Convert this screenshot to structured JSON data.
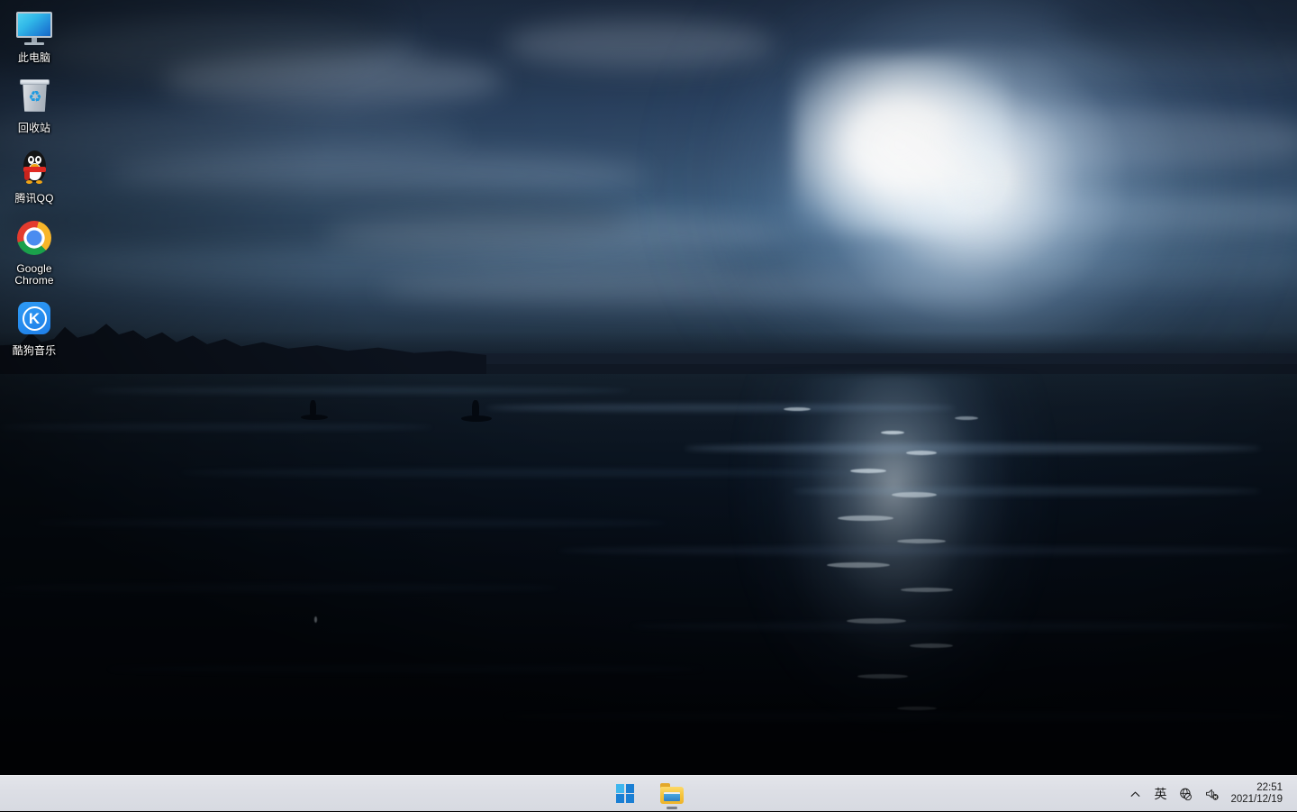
{
  "desktop": {
    "wallpaper_description": "Moonlit night seascape with bright moon glow, clouds, distant treeline hills and dark ocean waves with moonlight reflection",
    "wallpaper_colors": {
      "sky_top": "#1d2c42",
      "sky_mid": "#3d5d7d",
      "moon_glow": "#ffffff",
      "ocean_top": "#15222f",
      "ocean_bottom": "#020509",
      "hills": "#16202f"
    },
    "icons": [
      {
        "id": "this-pc",
        "label": "此电脑",
        "icon": "monitor-icon"
      },
      {
        "id": "recycle-bin",
        "label": "回收站",
        "icon": "recycle-bin-icon"
      },
      {
        "id": "tencent-qq",
        "label": "腾讯QQ",
        "icon": "qq-penguin-icon"
      },
      {
        "id": "google-chrome",
        "label": "Google Chrome",
        "icon": "chrome-icon"
      },
      {
        "id": "kugou-music",
        "label": "酷狗音乐",
        "icon": "kugou-icon",
        "glyph": "K"
      }
    ]
  },
  "taskbar": {
    "background_color": "#dcdee5",
    "buttons": [
      {
        "id": "start",
        "name": "start-button",
        "icon": "windows-logo-icon",
        "tooltip": "开始"
      },
      {
        "id": "file-explorer",
        "name": "file-explorer-button",
        "icon": "folder-icon",
        "tooltip": "文件资源管理器",
        "running": true
      }
    ],
    "tray": {
      "show_hidden_icons": {
        "icon": "chevron-up-icon",
        "glyph": "︿"
      },
      "input_method": {
        "icon": "ime-icon",
        "label": "英"
      },
      "network": {
        "icon": "globe-no-internet-icon",
        "status": "无 Internet 访问权限"
      },
      "volume": {
        "icon": "speaker-muted-icon",
        "status": "静音"
      },
      "clock": {
        "time": "22:51",
        "date": "2021/12/19"
      }
    }
  }
}
